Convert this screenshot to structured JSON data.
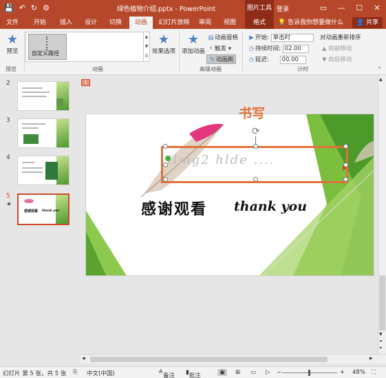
{
  "titlebar": {
    "doc_title": "绿色植物介绍.pptx - PowerPoint",
    "context_tools": "图片工具",
    "login": "登录",
    "qat": {
      "save_icon": "save-icon",
      "undo_icon": "undo-icon",
      "redo_icon": "redo-icon",
      "customize_icon": "customize-icon"
    },
    "controls": {
      "restore": "▭",
      "minimize": "—",
      "maximize": "☐",
      "close": "✕"
    }
  },
  "tabs": [
    "文件",
    "开始",
    "插入",
    "设计",
    "切换",
    "动画",
    "幻灯片放映",
    "审阅",
    "视图",
    "格式"
  ],
  "active_tab": "动画",
  "tell_me": "告诉我你想要做什么",
  "share": "共享",
  "ribbon": {
    "preview": {
      "label": "预览",
      "group": "预览"
    },
    "animation": {
      "gallery_item": "自定义路径",
      "group": "动画",
      "effect_options": "效果选项"
    },
    "advanced": {
      "group": "高级动画",
      "add_animation": "添加动画",
      "animation_pane": "动画窗格",
      "trigger": "触发",
      "animation_painter": "动画刷"
    },
    "timing": {
      "group": "计时",
      "start_label": "开始:",
      "start_value": "单击时",
      "duration_label": "持续时间:",
      "duration_value": "02.00",
      "delay_label": "延迟:",
      "delay_value": "00.00",
      "reorder": "对动画重新排序",
      "move_earlier": "向前移动",
      "move_later": "向后移动"
    }
  },
  "slides": [
    {
      "num": "2"
    },
    {
      "num": "3"
    },
    {
      "num": "4"
    },
    {
      "num": "5",
      "star": "★",
      "thumb_text_cn": "感谢观看",
      "thumb_text_en": "thank you"
    }
  ],
  "editor": {
    "animation_tag": "1",
    "heading": "书写",
    "signature_text": "ilmg2 hlde ....",
    "thanks_cn": "感谢观看",
    "thanks_en": "thank you"
  },
  "statusbar": {
    "slide_info": "幻灯片 第 5 张，共 5 张",
    "language": "中文(中国)",
    "notes": "备注",
    "comments": "批注",
    "zoom": "48%"
  }
}
